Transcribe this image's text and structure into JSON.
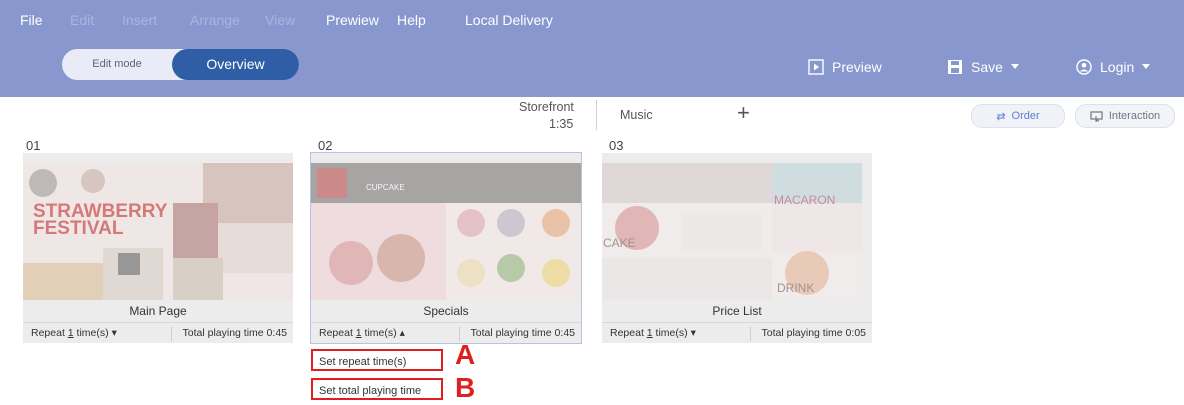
{
  "menubar": {
    "items": [
      {
        "label": "File"
      },
      {
        "label": "Edit"
      },
      {
        "label": "Insert"
      },
      {
        "label": "Arrange"
      },
      {
        "label": "View"
      },
      {
        "label": "Prewiew"
      },
      {
        "label": "Help"
      },
      {
        "label": "Local Delivery"
      }
    ]
  },
  "mode": {
    "edit_label": "Edit mode",
    "overview_label": "Overview"
  },
  "toolbar": {
    "preview_label": "Preview",
    "save_label": "Save",
    "login_label": "Login"
  },
  "timeline": {
    "storefront_label": "Storefront",
    "storefront_time": "1:35",
    "music_label": "Music"
  },
  "view_buttons": {
    "order_label": "Order",
    "interaction_label": "Interaction"
  },
  "slides": [
    {
      "number": "01",
      "name": "Main Page",
      "repeat_prefix": "Repeat",
      "repeat_count": "1",
      "repeat_unit": "time(s)",
      "total_label": "Total playing time 0:45",
      "thumb_title": "STRAWBERRY\nFESTIVAL"
    },
    {
      "number": "02",
      "name": "Specials",
      "repeat_prefix": "Repeat",
      "repeat_count": "1",
      "repeat_unit": "time(s)",
      "total_label": "Total playing time 0:45",
      "thumb_title": "CUPCAKE"
    },
    {
      "number": "03",
      "name": "Price List",
      "repeat_prefix": "Repeat",
      "repeat_count": "1",
      "repeat_unit": "time(s)",
      "total_label": "Total playing time 0:05",
      "thumb_cake": "CAKE",
      "thumb_macaron": "MACARON",
      "thumb_drink": "DRINK"
    }
  ],
  "popup": {
    "set_repeat_label": "Set repeat time(s)",
    "set_total_label": "Set total playing time"
  },
  "annotations": {
    "a": "A",
    "b": "B"
  },
  "colors": {
    "topbar": "#8898cf",
    "accent": "#2f5ea6",
    "callout": "#e02020"
  }
}
